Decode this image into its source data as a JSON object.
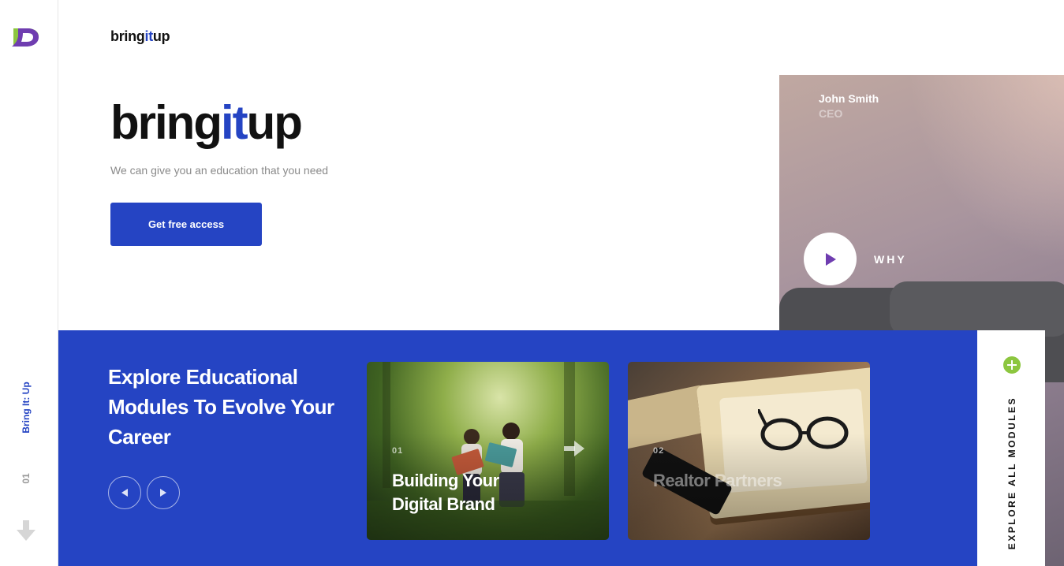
{
  "sidebar": {
    "brand": "Bring It: Up",
    "page_number": "01"
  },
  "header": {
    "logo_pre": "bring",
    "logo_accent": "it",
    "logo_post": "up"
  },
  "hero": {
    "title_pre": "bring",
    "title_accent": "it",
    "title_post": "up",
    "subtitle": "We can give you an education that you need",
    "cta_label": "Get free access"
  },
  "video": {
    "name": "John Smith",
    "role": "CEO",
    "play_label": "WHY"
  },
  "modules": {
    "title": "Explore Educational Modules To Evolve Your Career",
    "cards": [
      {
        "number": "01",
        "title": "Building Your Digital Brand"
      },
      {
        "number": "02",
        "title": "Realtor Partners"
      }
    ],
    "explore_all": "EXPLORE ALL MODULES"
  },
  "colors": {
    "brand_blue": "#2544c3",
    "accent_green": "#8cc63f",
    "logo_purple": "#6f3db0"
  }
}
